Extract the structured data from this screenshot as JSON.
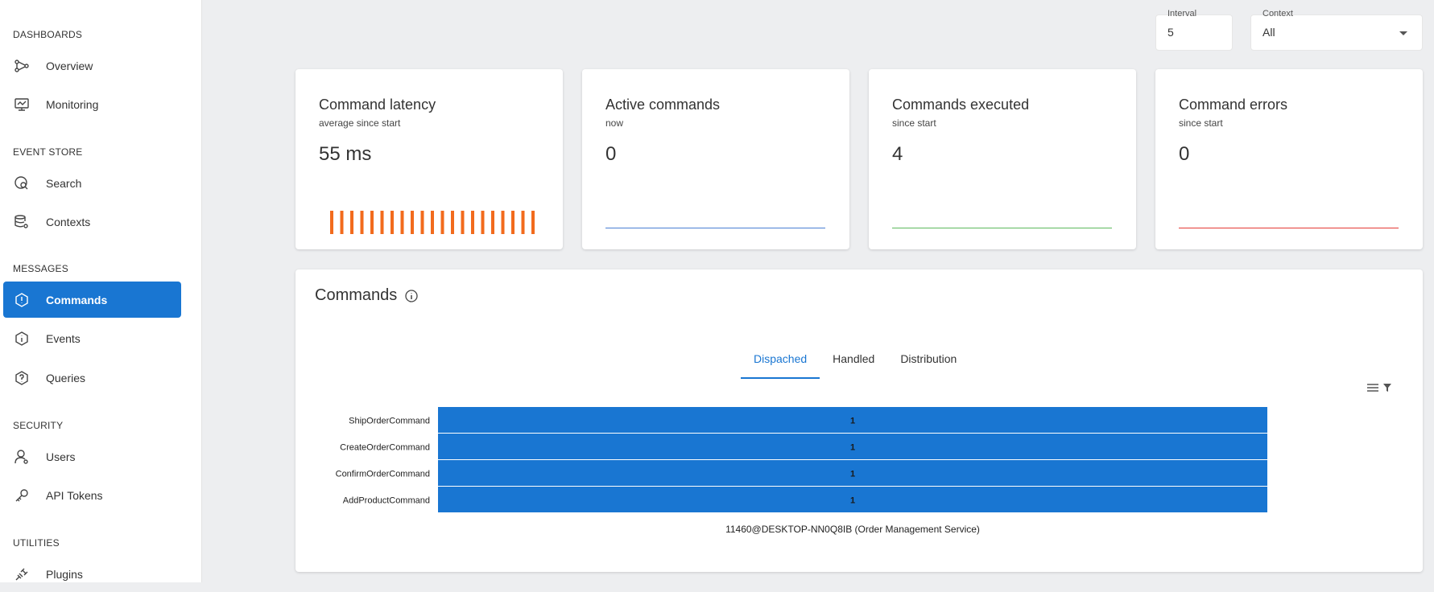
{
  "sidebar": {
    "sections": [
      {
        "title": "DASHBOARDS",
        "items": [
          {
            "label": "Overview",
            "icon": "overview-icon"
          },
          {
            "label": "Monitoring",
            "icon": "monitoring-icon"
          }
        ]
      },
      {
        "title": "EVENT STORE",
        "items": [
          {
            "label": "Search",
            "icon": "search-icon"
          },
          {
            "label": "Contexts",
            "icon": "contexts-icon"
          }
        ]
      },
      {
        "title": "MESSAGES",
        "items": [
          {
            "label": "Commands",
            "icon": "commands-icon",
            "active": true
          },
          {
            "label": "Events",
            "icon": "events-icon"
          },
          {
            "label": "Queries",
            "icon": "queries-icon"
          }
        ]
      },
      {
        "title": "SECURITY",
        "items": [
          {
            "label": "Users",
            "icon": "users-icon"
          },
          {
            "label": "API Tokens",
            "icon": "key-icon"
          }
        ]
      },
      {
        "title": "UTILITIES",
        "items": [
          {
            "label": "Plugins",
            "icon": "plugins-icon"
          }
        ]
      }
    ]
  },
  "controls": {
    "interval_label": "Interval",
    "interval_value": "5",
    "context_label": "Context",
    "context_value": "All"
  },
  "cards": [
    {
      "title": "Command latency",
      "subtitle": "average since start",
      "value": "55 ms",
      "color": "#f26b1d"
    },
    {
      "title": "Active commands",
      "subtitle": "now",
      "value": "0",
      "color": "#4a7fd4"
    },
    {
      "title": "Commands executed",
      "subtitle": "since start",
      "value": "4",
      "color": "#5cb85c"
    },
    {
      "title": "Command errors",
      "subtitle": "since start",
      "value": "0",
      "color": "#e53935"
    }
  ],
  "panel": {
    "title": "Commands",
    "tabs": [
      "Dispached",
      "Handled",
      "Distribution"
    ],
    "active_tab": "Dispached"
  },
  "chart_data": {
    "type": "bar",
    "orientation": "horizontal",
    "categories": [
      "ShipOrderCommand",
      "CreateOrderCommand",
      "ConfirmOrderCommand",
      "AddProductCommand"
    ],
    "series": [
      {
        "name": "11460@DESKTOP-NN0Q8IB (Order Management Service)",
        "values": [
          1,
          1,
          1,
          1
        ],
        "color": "#1976d2"
      }
    ],
    "data_labels": [
      "1",
      "1",
      "1",
      "1"
    ],
    "legend": "11460@DESKTOP-NN0Q8IB (Order Management Service)",
    "legend_position": "bottom"
  }
}
